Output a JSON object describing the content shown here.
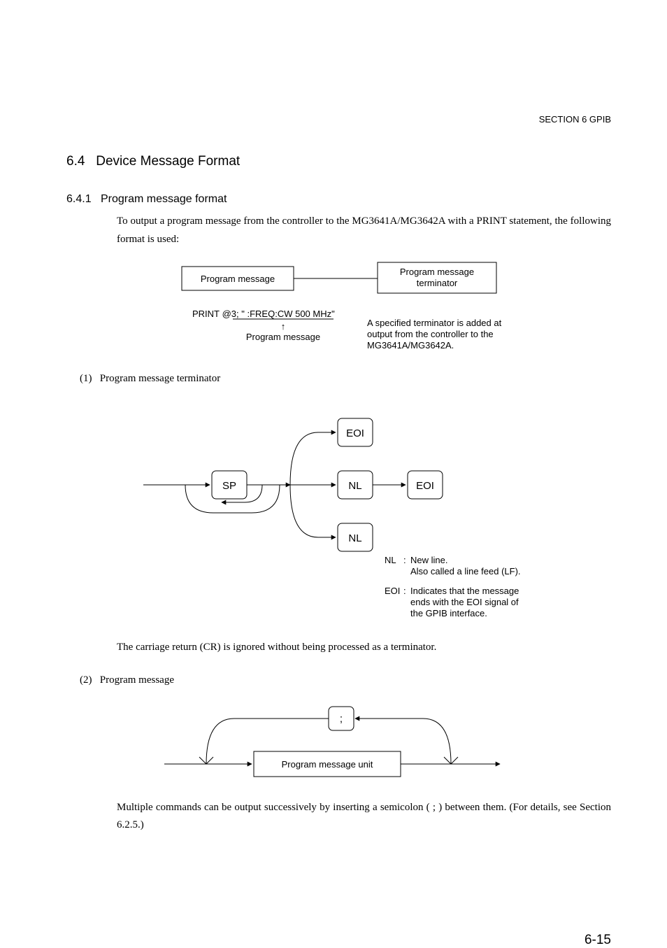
{
  "header": {
    "section": "SECTION 6   GPIB"
  },
  "h1": {
    "num": "6.4",
    "title": "Device Message Format"
  },
  "h2": {
    "num": "6.4.1",
    "title": "Program message format"
  },
  "intro": "To output a program message from the controller to the MG3641A/MG3642A with a PRINT statement, the following format is used:",
  "diagram1": {
    "box_left": "Program message",
    "box_right_top": "Program message",
    "box_right_bot": "terminator",
    "example": "PRINT @3; \" :FREQ:CW 500 MHz\"",
    "arrow_label": "↑",
    "ex_sub": "Program message",
    "note1": "A specified terminator is added at",
    "note2": "output from the controller to the",
    "note3": "MG3641A/MG3642A."
  },
  "item1": {
    "num": "(1)",
    "title": "Program message terminator"
  },
  "diagram2": {
    "sp": "SP",
    "nl": "NL",
    "eoi": "EOI",
    "legend_nl_k": "NL",
    "legend_nl_c": ":",
    "legend_nl_1": "New line.",
    "legend_nl_2": "Also called a line feed (LF).",
    "legend_eoi_k": "EOI",
    "legend_eoi_c": ":",
    "legend_eoi_1": "Indicates that the message",
    "legend_eoi_2": "ends with the EOI signal of",
    "legend_eoi_3": "the GPIB interface."
  },
  "para2": "The carriage return (CR) is ignored without being processed as a terminator.",
  "item2": {
    "num": "(2)",
    "title": "Program message"
  },
  "diagram3": {
    "semi": ";",
    "unit": "Program message unit"
  },
  "para3": "Multiple commands can be output successively by inserting a semicolon ( ; ) between them.  (For details, see Section 6.2.5.)",
  "pageNum": "6-15"
}
